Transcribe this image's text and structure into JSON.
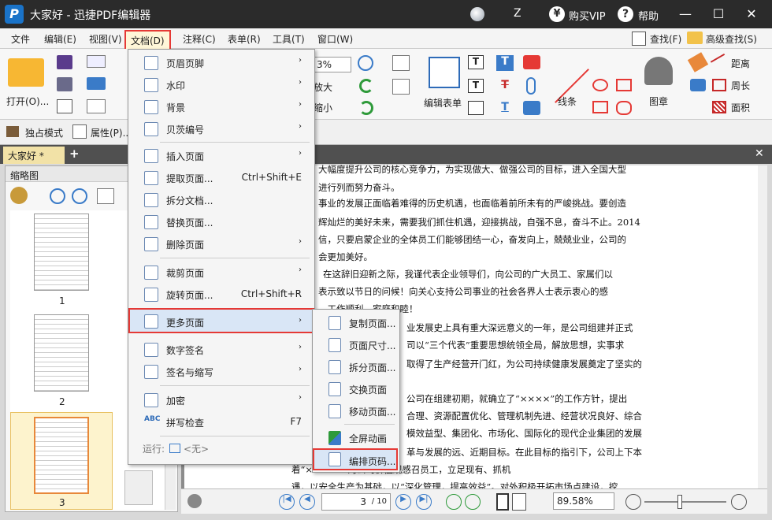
{
  "titlebar": {
    "app_logo": "P",
    "title": "大家好 - 迅捷PDF编辑器",
    "user": "Z",
    "vip_icon": "¥",
    "vip_label": "购买VIP",
    "help_icon": "?",
    "help_label": "帮助",
    "min": "—",
    "max": "☐",
    "close": "✕"
  },
  "menubar": {
    "items": [
      "文件",
      "编辑(E)",
      "视图(V)",
      "文档(D)",
      "注释(C)",
      "表单(R)",
      "工具(T)",
      "窗口(W)"
    ],
    "find": "查找(F)",
    "advanced_find": "高级查找(S)"
  },
  "toolbar": {
    "open": "打开(O)...",
    "zoom_value": "3%",
    "zoom_in_big": "放大",
    "zoom_out_small": "缩小",
    "edit_form": "编辑表单",
    "line": "线条",
    "stamp": "图章",
    "distance": "距离",
    "perimeter": "周长",
    "area": "面积",
    "exclusive_mode": "独占模式",
    "properties": "属性(P)..."
  },
  "tabbar": {
    "tab_label": "大家好 *",
    "add": "+",
    "close": "✕"
  },
  "thumbs": {
    "title": "缩略图",
    "pages": [
      "1",
      "2",
      "3"
    ]
  },
  "doc": {
    "lines": [
      "大幅度提升公司的核心竞争力，为实现做大、做强公司的目标，进入全国大型",
      "进行列而努力奋斗。",
      "事业的发展正面临着难得的历史机遇，也面临着前所未有的严峻挑战。要创造",
      "辉灿烂的美好未来，需要我们抓住机遇，迎接挑战，自强不息，奋斗不止。2014",
      "信，只要启蒙企业的全体员工们能够团结一心，奋发向上，兢兢业业，公司的",
      "会更加美好。",
      "在这辞旧迎新之际，我谨代表企业领导们，向公司的广大员工、家属们以",
      "表示致以节日的问候！向关心支持公司事业的社会各界人士表示衷心的感",
      "，工作顺利，家庭和睦！",
      "业发展史上具有重大深远意义的一年，是公司组建并正式",
      "司以“三个代表”重要思想统领全局，解放思想，实事求",
      "取得了生产经营开门红，为公司持续健康发展奠定了坚实的",
      "公司在组建初期，就确立了“××××”的工作方针，提出",
      "合理、资源配置优化、管理机制先进、经营状况良好、综合",
      "模效益型、集团化、市场化、国际化的现代企业集团的发展",
      "革与发展的远、近期目标。在此目标的指引下，公司上下本",
      "着“×××××”的公司价值观感召员工，立足现有、抓机",
      "遇，以安全生产为基础，以“深化管理，提高效益”。对外积极开拓市场点建设，挖"
    ]
  },
  "status": {
    "page_current": "3",
    "page_total": "/ 10",
    "zoom": "89.58%"
  },
  "doc_menu": {
    "items": [
      {
        "label": "页眉页脚",
        "shortcut": "",
        "arrow": "›"
      },
      {
        "label": "水印",
        "shortcut": "",
        "arrow": "›"
      },
      {
        "label": "背景",
        "shortcut": "",
        "arrow": "›"
      },
      {
        "label": "贝茨编号",
        "shortcut": "",
        "arrow": "›"
      },
      {
        "label": "插入页面",
        "shortcut": "",
        "arrow": "›"
      },
      {
        "label": "提取页面...",
        "shortcut": "Ctrl+Shift+E",
        "arrow": ""
      },
      {
        "label": "拆分文档...",
        "shortcut": "",
        "arrow": ""
      },
      {
        "label": "替换页面...",
        "shortcut": "",
        "arrow": ""
      },
      {
        "label": "删除页面",
        "shortcut": "",
        "arrow": "›"
      },
      {
        "label": "裁剪页面",
        "shortcut": "",
        "arrow": "›"
      },
      {
        "label": "旋转页面...",
        "shortcut": "Ctrl+Shift+R",
        "arrow": ""
      },
      {
        "label": "更多页面",
        "shortcut": "",
        "arrow": "›"
      },
      {
        "label": "数字签名",
        "shortcut": "",
        "arrow": "›"
      },
      {
        "label": "签名与缩写",
        "shortcut": "",
        "arrow": "›"
      },
      {
        "label": "加密",
        "shortcut": "",
        "arrow": "›"
      },
      {
        "label": "拼写检查",
        "shortcut": "F7",
        "arrow": ""
      }
    ],
    "run_label": "运行:",
    "run_value": "<无>",
    "spell_icon": "ABC"
  },
  "more_pages_menu": {
    "items": [
      "复制页面...",
      "页面尺寸...",
      "拆分页面...",
      "交换页面",
      "移动页面...",
      "全屏动画",
      "编排页码..."
    ]
  }
}
